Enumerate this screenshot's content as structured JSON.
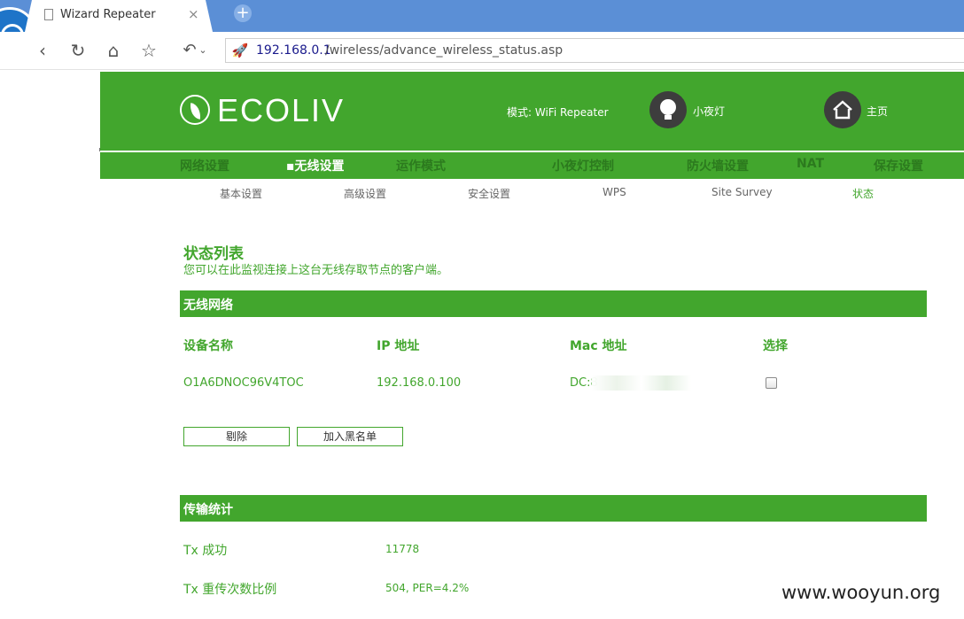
{
  "browser": {
    "tab_title": "Wizard Repeater",
    "tab_close": "×",
    "new_tab": "+",
    "url_host": "192.168.0.1",
    "url_path": "/wireless/advance_wireless_status.asp",
    "buttons": {
      "back": "‹",
      "reload": "↻",
      "home": "⌂",
      "star": "☆",
      "undo": "↶",
      "undo_dropdown": "⌄"
    },
    "icons": [
      "browser-logo-icon",
      "page-icon",
      "rocket-icon"
    ]
  },
  "header": {
    "logo_text": "ECOLIV",
    "mode_label": "模式:",
    "mode_value": "WiFi Repeater",
    "nightlight_label": "小夜灯",
    "home_label": "主页"
  },
  "main_nav": [
    {
      "label": "网络设置"
    },
    {
      "label": "▪无线设置",
      "active": true
    },
    {
      "label": "运作模式"
    },
    {
      "label": "小夜灯控制"
    },
    {
      "label": "防火墙设置"
    },
    {
      "label": "NAT"
    },
    {
      "label": "保存设置"
    }
  ],
  "sub_nav": [
    {
      "label": "基本设置"
    },
    {
      "label": "高级设置"
    },
    {
      "label": "安全设置"
    },
    {
      "label": "WPS"
    },
    {
      "label": "Site Survey"
    },
    {
      "label": "状态",
      "active": true
    }
  ],
  "page": {
    "title": "状态列表",
    "description": "您可以在此监视连接上这台无线存取节点的客户端。"
  },
  "wireless_section": {
    "title": "无线网络",
    "columns": [
      "设备名称",
      "IP 地址",
      "Mac 地址",
      "选择"
    ],
    "rows": [
      {
        "name": "O1A6DNOC96V4TOC",
        "ip": "192.168.0.100",
        "mac": "DC:8",
        "selected": false
      }
    ],
    "delete_button": "剔除",
    "blacklist_button": "加入黑名单"
  },
  "stats_section": {
    "title": "传输统计",
    "tx_success_label": "Tx 成功",
    "tx_success_value": "11778",
    "tx_retry_label": "Tx 重传次数比例",
    "tx_retry_value": "504, PER=4.2%"
  },
  "watermark": "www.wooyun.org",
  "colors": {
    "brand_green": "#42a62d",
    "dark_green_nav": "#2c7a1e",
    "browser_blue": "#5b8fd6",
    "icon_dark": "#3d3d3d"
  }
}
